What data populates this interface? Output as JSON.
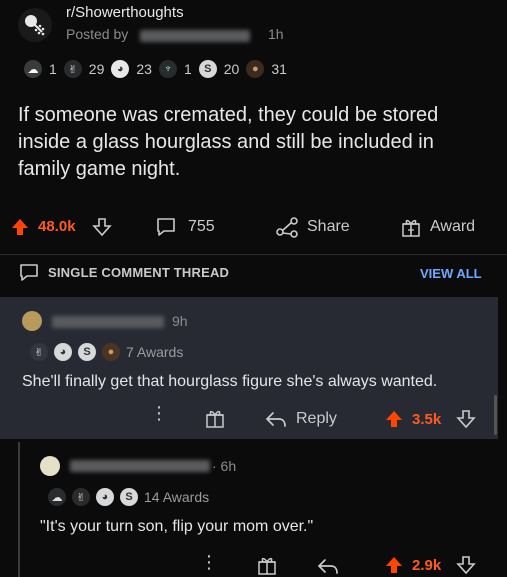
{
  "post": {
    "subreddit": "r/Showerthoughts",
    "posted_prefix": "Posted by",
    "time": "1h",
    "awards": [
      "1",
      "29",
      "23",
      "1",
      "20",
      "31"
    ],
    "title": "If someone was cremated, they could be stored inside a glass hourglass and still be included in family game night.",
    "upvotes": "48.0k",
    "comments": "755",
    "share_label": "Share",
    "award_label": "Award"
  },
  "thread": {
    "header": "SINGLE COMMENT THREAD",
    "view_all": "VIEW ALL"
  },
  "comments": [
    {
      "time": "9h",
      "awards_text": "7 Awards",
      "body": "She'll finally get that hourglass figure she's always wanted.",
      "reply_label": "Reply",
      "votes": "3.5k"
    },
    {
      "time": "· 6h",
      "awards_text": "14 Awards",
      "body": "\"It's your turn son, flip your mom over.\"",
      "votes": "2.9k"
    }
  ],
  "colors": {
    "upvote": "#ff4500",
    "link": "#6fa8ff",
    "highlight_bg": "#272a33"
  }
}
